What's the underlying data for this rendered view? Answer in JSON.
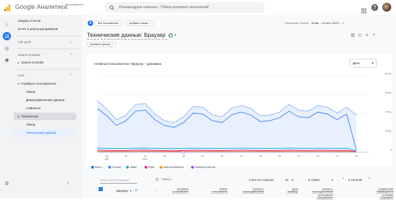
{
  "header": {
    "app_title": "Google Аналитика",
    "account_label": "Все аккаунты",
    "account_sub": "",
    "search_placeholder": "Рекомендуем поискать: \"Обзор интернет-технологий\""
  },
  "sidebar": {
    "items": [
      {
        "label": "Сводка отчетов"
      },
      {
        "label": "Отчет в реальном времени"
      },
      {
        "label": "Life cycle"
      },
      {
        "label": "Search Console"
      },
      {
        "label": "Search Console"
      },
      {
        "label": "User"
      },
      {
        "label": "Атрибуты пользователя"
      },
      {
        "label": "Обзор"
      },
      {
        "label": "Демографические данные"
      },
      {
        "label": "Audiences"
      },
      {
        "label": "Технологии"
      },
      {
        "label": "Обзор"
      },
      {
        "label": "Технические данные"
      }
    ]
  },
  "report": {
    "segment_chip": "Все пользователи",
    "compare_chip": "Добавить акцию",
    "date_range_label": "Последние 28 дней",
    "date_range": "28 авг. – 24 сент. 2024 г.",
    "title": "Технические данные: Браузер",
    "add_filter": "Добавить фильтр",
    "chart_title": "Активные пользователи / Браузер – динамика",
    "granularity": "День"
  },
  "chart_data": {
    "type": "line",
    "title": "Активные пользователи / Браузер – динамика",
    "xlabel": "",
    "ylabel": "",
    "x_ticks": [
      "29\nавг.",
      "31",
      "01\nсент.",
      "03",
      "05",
      "07",
      "09",
      "11",
      "13",
      "15",
      "17",
      "19",
      "21",
      "23"
    ],
    "y_ticks": [
      "8 тыс.",
      "6 тыс.",
      "4 тыс.",
      "2 тыс.",
      "0"
    ],
    "ylim": [
      0,
      8000
    ],
    "grid": true,
    "legend_position": "bottom",
    "x": [
      "28",
      "29",
      "30",
      "31",
      "01",
      "02",
      "03",
      "04",
      "05",
      "06",
      "07",
      "08",
      "09",
      "10",
      "11",
      "12",
      "13",
      "14",
      "15",
      "16",
      "17",
      "18",
      "19",
      "20",
      "21",
      "22",
      "23",
      "24"
    ],
    "series": [
      {
        "name": "Всего",
        "color": "#1a73e8",
        "dashed": true,
        "values": [
          5400,
          4500,
          3400,
          3900,
          5000,
          5100,
          4000,
          3300,
          3100,
          3700,
          4800,
          4700,
          3900,
          3700,
          4600,
          4900,
          4600,
          3800,
          3900,
          4200,
          5000,
          4400,
          4300,
          4900,
          4700,
          4100,
          4700,
          3900
        ]
      },
      {
        "name": "Chrome",
        "color": "#4285f4",
        "values": [
          4600,
          3800,
          2800,
          3300,
          4300,
          4400,
          3400,
          2800,
          2600,
          3100,
          4100,
          4000,
          3300,
          3100,
          3900,
          4200,
          3900,
          3200,
          3300,
          3600,
          4300,
          3700,
          3600,
          4200,
          4000,
          3400,
          4000,
          250
        ]
      },
      {
        "name": "Safari",
        "color": "#12b5cb",
        "values": [
          420,
          400,
          380,
          390,
          420,
          430,
          400,
          390,
          380,
          400,
          420,
          410,
          400,
          390,
          410,
          420,
          410,
          400,
          390,
          400,
          430,
          410,
          400,
          420,
          410,
          400,
          420,
          150
        ]
      },
      {
        "name": "Edge",
        "color": "#e52592",
        "values": [
          220,
          200,
          170,
          180,
          210,
          220,
          190,
          170,
          160,
          180,
          210,
          200,
          190,
          180,
          200,
          210,
          200,
          180,
          180,
          190,
          210,
          200,
          190,
          210,
          200,
          190,
          200,
          80
        ]
      },
      {
        "name": "Android Webview",
        "color": "#f29900",
        "values": [
          90,
          90,
          80,
          85,
          90,
          95,
          85,
          80,
          80,
          85,
          90,
          90,
          85,
          85,
          90,
          90,
          90,
          85,
          85,
          85,
          90,
          90,
          85,
          90,
          90,
          85,
          90,
          40
        ]
      },
      {
        "name": "Samsung Internet",
        "color": "#a142f4",
        "values": [
          50,
          45,
          40,
          45,
          50,
          50,
          45,
          40,
          40,
          45,
          50,
          50,
          45,
          45,
          50,
          50,
          50,
          45,
          45,
          45,
          50,
          50,
          45,
          50,
          50,
          45,
          50,
          20
        ]
      }
    ]
  },
  "table": {
    "search_dimension_placeholder": "Поиск на данной вкладке",
    "search_placeholder": "Поиск...",
    "rows_per_page_label": "Строк на странице:",
    "rows_per_page": "10",
    "goto_label": "К строке:",
    "goto_value": "1",
    "pagination": "1–10 из 20",
    "dimension_label": "Браузер",
    "columns": [
      "Активные\nпользователи",
      "Новые\nпользователи",
      "Сеансы с\nвзаимодействием",
      "Доля\nвзаимод.",
      "Сеансы с\nвзаимодействием\nна активного\nпользователя",
      "Среднее вре\nвзаимодейств\nна активн\nпользовате"
    ]
  },
  "colors": {
    "accent": "#1a73e8",
    "logo_orange": "#f9ab00",
    "logo_red": "#e37400",
    "sidebar_bg": "#f1f3f4"
  }
}
